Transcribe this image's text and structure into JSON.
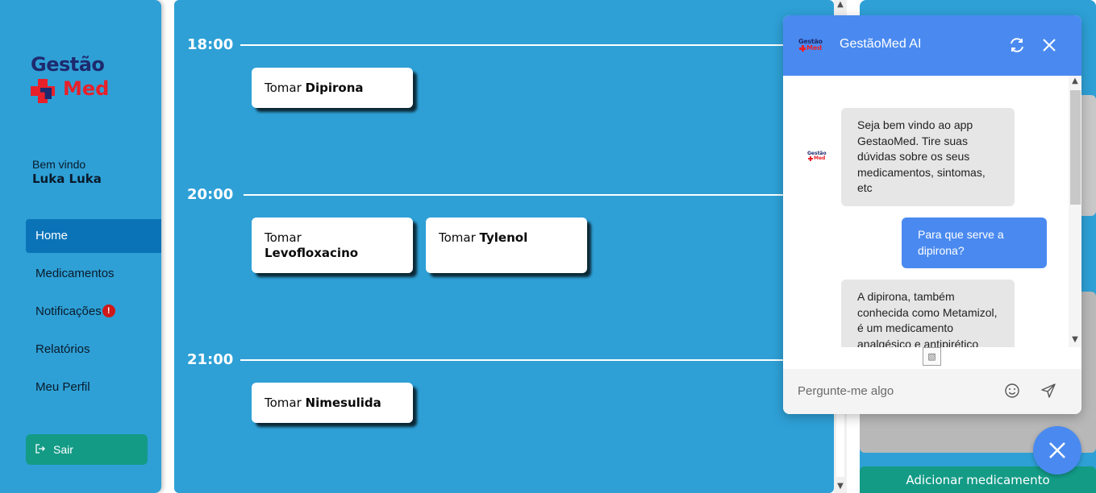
{
  "sidebar": {
    "logo_top": "Gestão",
    "logo_bottom": "Med",
    "welcome": "Bem vindo",
    "user_name": "Luka Luka",
    "nav": [
      {
        "label": "Home"
      },
      {
        "label": "Medicamentos"
      },
      {
        "label": "Notificações",
        "badge": "!"
      },
      {
        "label": "Relatórios"
      },
      {
        "label": "Meu Perfil"
      }
    ],
    "logout_label": "Sair"
  },
  "schedule": {
    "times": [
      "18:00",
      "20:00",
      "21:00"
    ],
    "entries": [
      {
        "prefix": "Tomar",
        "medicine": "Dipirona"
      },
      {
        "prefix": "Tomar",
        "medicine": "Levofloxacino"
      },
      {
        "prefix": "Tomar",
        "medicine": "Tylenol"
      },
      {
        "prefix": "Tomar",
        "medicine": "Nimesulida"
      }
    ]
  },
  "right_panel": {
    "add_button": "Adicionar medicamento"
  },
  "chat": {
    "title": "GestãoMed AI",
    "messages": [
      {
        "from": "bot",
        "text": "Seja bem vindo ao app GestaoMed. Tire suas dúvidas sobre os seus medicamentos, sintomas, etc"
      },
      {
        "from": "user",
        "text": "Para que serve a dipirona?"
      },
      {
        "from": "bot",
        "text": "A dipirona, também conhecida como Metamizol, é um medicamento analgésico e antipirético"
      }
    ],
    "input_placeholder": "Pergunte-me algo"
  },
  "icons": {
    "refresh": "refresh-icon",
    "close": "close-icon",
    "emoji": "smiley-icon",
    "send": "send-icon",
    "logout": "logout-icon",
    "image": "broken-image-icon"
  },
  "colors": {
    "primary_blue": "#2ea0d6",
    "active_nav": "#0a73b8",
    "teal": "#139b86",
    "chat_blue": "#4a8af0",
    "badge_red": "#d01818"
  }
}
